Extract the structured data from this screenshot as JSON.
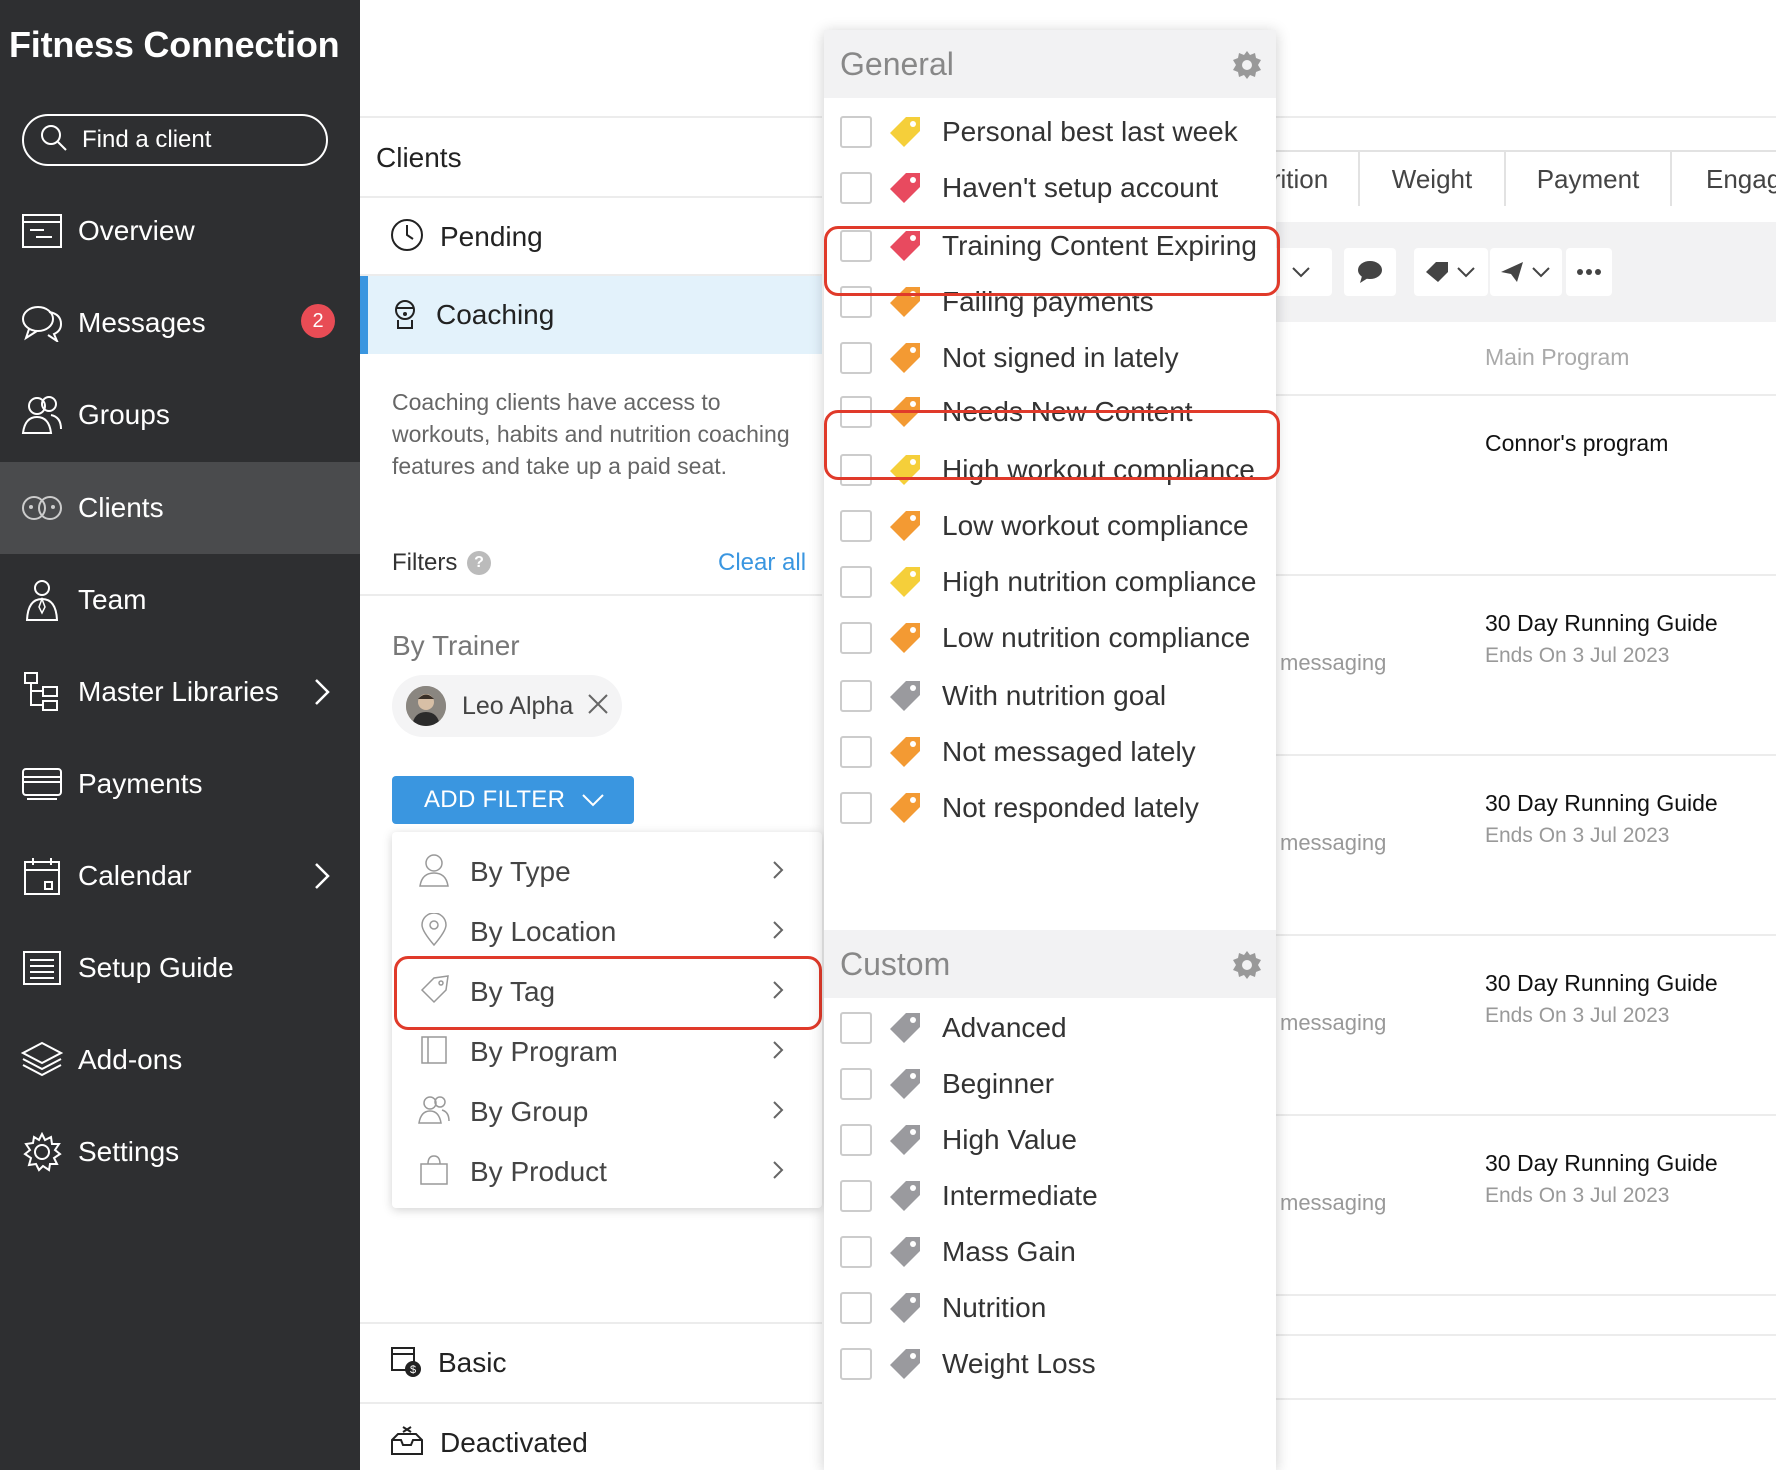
{
  "app": {
    "title": "Fitness Connection"
  },
  "search": {
    "label": "Find a client"
  },
  "nav": {
    "overview": "Overview",
    "messages": "Messages",
    "messages_badge": "2",
    "groups": "Groups",
    "clients": "Clients",
    "team": "Team",
    "master_libraries": "Master Libraries",
    "payments": "Payments",
    "calendar": "Calendar",
    "setup_guide": "Setup Guide",
    "addons": "Add-ons",
    "settings": "Settings"
  },
  "clients_panel": {
    "heading": "Clients",
    "pending": "Pending",
    "coaching": "Coaching",
    "description": "Coaching clients have access to workouts, habits and nutrition coaching features and take up a paid seat.",
    "filters_label": "Filters",
    "filters_help": "?",
    "clear_all": "Clear all",
    "by_trainer": "By Trainer",
    "trainer_chip": "Leo Alpha",
    "add_filter": "ADD FILTER",
    "basic": "Basic",
    "deactivated": "Deactivated"
  },
  "filter_menu": {
    "items": [
      "By Type",
      "By Location",
      "By Tag",
      "By Program",
      "By Group",
      "By Product"
    ],
    "highlighted": "By Tag"
  },
  "tag_dropdown": {
    "general_header": "General",
    "general_tags": [
      {
        "label": "Personal best last week",
        "color": "#f5cf3a"
      },
      {
        "label": "Haven't setup account",
        "color": "#e84a5f"
      },
      {
        "label": "Training Content Expiring",
        "color": "#e84a5f"
      },
      {
        "label": "Failing payments",
        "color": "#f39a33"
      },
      {
        "label": "Not signed in lately",
        "color": "#f39a33"
      },
      {
        "label": "Needs New Content",
        "color": "#f39a33"
      },
      {
        "label": "High workout compliance",
        "color": "#f5cf3a"
      },
      {
        "label": "Low workout compliance",
        "color": "#f39a33"
      },
      {
        "label": "High nutrition compliance",
        "color": "#f5cf3a"
      },
      {
        "label": "Low nutrition compliance",
        "color": "#f39a33"
      },
      {
        "label": "With nutrition goal",
        "color": "#9a9a9e"
      },
      {
        "label": "Not messaged lately",
        "color": "#f39a33"
      },
      {
        "label": "Not responded lately",
        "color": "#f39a33"
      }
    ],
    "custom_header": "Custom",
    "custom_tags": [
      {
        "label": "Advanced",
        "color": "#9a9a9e"
      },
      {
        "label": "Beginner",
        "color": "#9a9a9e"
      },
      {
        "label": "High Value",
        "color": "#9a9a9e"
      },
      {
        "label": "Intermediate",
        "color": "#9a9a9e"
      },
      {
        "label": "Mass Gain",
        "color": "#9a9a9e"
      },
      {
        "label": "Nutrition",
        "color": "#9a9a9e"
      },
      {
        "label": "Weight Loss",
        "color": "#9a9a9e"
      }
    ],
    "highlighted": [
      "Training Content Expiring",
      "Needs New Content"
    ]
  },
  "background_table": {
    "tabs": [
      "rition",
      "Weight",
      "Payment",
      "Engag"
    ],
    "column_header": "Main Program",
    "rows": [
      {
        "program": "Connor's program",
        "ends": "",
        "status": ""
      },
      {
        "program": "30 Day Running Guide",
        "ends": "Ends On 3 Jul 2023",
        "status": "messaging"
      },
      {
        "program": "30 Day Running Guide",
        "ends": "Ends On 3 Jul 2023",
        "status": "messaging"
      },
      {
        "program": "30 Day Running Guide",
        "ends": "Ends On 3 Jul 2023",
        "status": "messaging"
      },
      {
        "program": "30 Day Running Guide",
        "ends": "Ends On 3 Jul 2023",
        "status": "messaging"
      }
    ]
  },
  "colors": {
    "sidebar_bg": "#2e2f31",
    "sidebar_active": "#4a4b4d",
    "accent_blue": "#3a96e0",
    "highlight_red": "#e03a2a",
    "badge_red": "#e84c55"
  }
}
